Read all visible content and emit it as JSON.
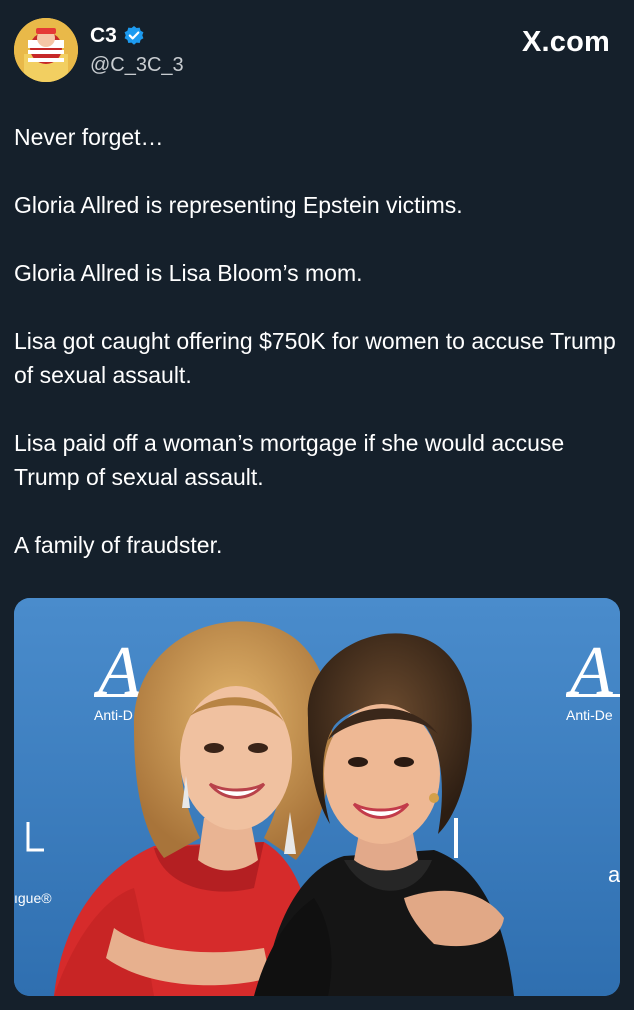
{
  "author": {
    "display_name": "C3",
    "handle": "@C_3C_3",
    "verified": true,
    "avatar_icon": "user-avatar"
  },
  "brand": {
    "label": "X.com"
  },
  "tweet": {
    "paragraphs": [
      "Never forget…",
      "Gloria Allred is representing Epstein victims.",
      "Gloria Allred is Lisa Bloom’s mom.",
      "Lisa got caught offering $750K for women to accuse Trump of sexual assault.",
      "Lisa paid off a woman’s mortgage if she would accuse Trump of sexual assault.",
      "A family of fraudster."
    ]
  },
  "media": {
    "backdrop_texts": {
      "logo_left": "A",
      "logo_right": "A",
      "caption_left": "Anti-D",
      "caption_right": "Anti-De",
      "edge_left": "ıgue®",
      "edge_right": "a"
    }
  },
  "colors": {
    "background": "#15202b",
    "verified": "#1d9bf0",
    "backdrop": "#3d7ec0"
  }
}
